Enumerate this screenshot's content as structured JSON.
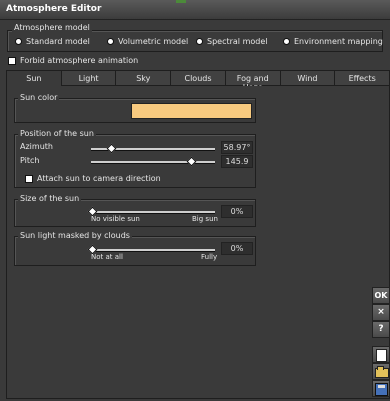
{
  "window": {
    "title": "Atmosphere Editor"
  },
  "atmosphere_model": {
    "label": "Atmosphere model",
    "options": [
      "Standard model",
      "Volumetric model",
      "Spectral model",
      "Environment mapping"
    ]
  },
  "forbid_animation": {
    "label": "Forbid atmosphere animation",
    "checked": false
  },
  "tabs": [
    "Sun",
    "Light",
    "Sky",
    "Clouds",
    "Fog and Haze",
    "Wind",
    "Effects"
  ],
  "sun_color": {
    "label": "Sun color",
    "color": "#f8ca7f"
  },
  "position": {
    "label": "Position of the sun",
    "azimuth_label": "Azimuth",
    "azimuth_value": "58.97°",
    "azimuth_fraction": 0.16,
    "pitch_label": "Pitch",
    "pitch_value": "145.9",
    "pitch_fraction": 0.81,
    "attach_label": "Attach sun to camera direction"
  },
  "size": {
    "label": "Size of the sun",
    "min_label": "No visible sun",
    "max_label": "Big sun",
    "value": "0%"
  },
  "masked": {
    "label": "Sun light masked by clouds",
    "min_label": "Not at all",
    "max_label": "Fully",
    "value": "0%"
  },
  "side_buttons": {
    "ok": "OK",
    "close": "×",
    "help": "?"
  }
}
